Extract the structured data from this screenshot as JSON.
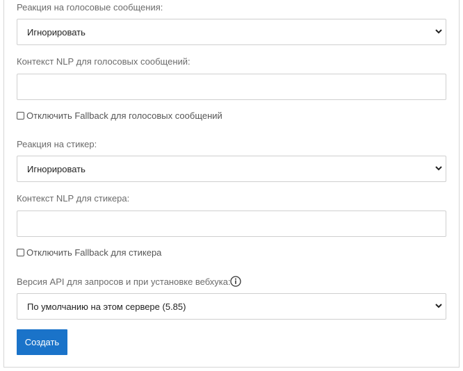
{
  "voice": {
    "reaction_label": "Реакция на голосовые сообщения:",
    "reaction_value": "Игнорировать",
    "nlp_label": "Контекст NLP для голосовых сообщений:",
    "nlp_value": "",
    "fallback_label": "Отключить Fallback для голосовых сообщений",
    "fallback_checked": false
  },
  "sticker": {
    "reaction_label": "Реакция на стикер:",
    "reaction_value": "Игнорировать",
    "nlp_label": "Контекст NLP для стикера:",
    "nlp_value": "",
    "fallback_label": "Отключить Fallback для стикера",
    "fallback_checked": false
  },
  "api": {
    "label": "Версия API для запросов и при установке вебхука:",
    "info_icon": "info-circle",
    "value": "По умолчанию на этом сервере (5.85)"
  },
  "submit": {
    "label": "Создать",
    "color": "#1a73c9"
  }
}
